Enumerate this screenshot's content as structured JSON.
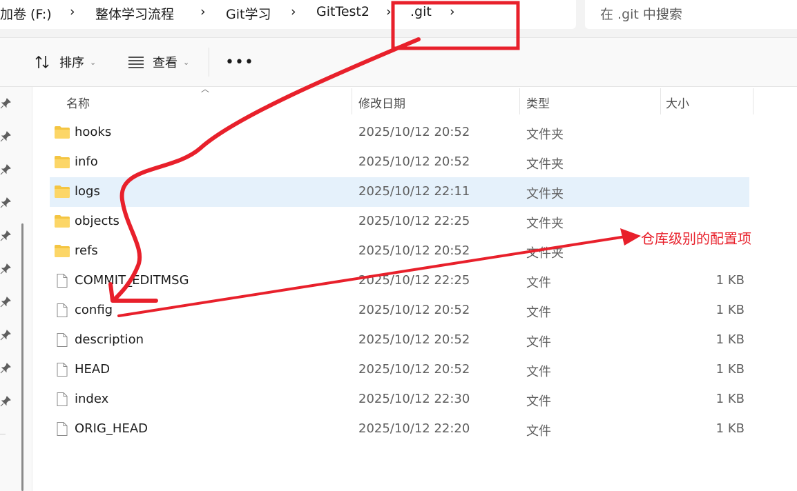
{
  "breadcrumb": {
    "items": [
      "加卷 (F:)",
      "整体学习流程",
      "Git学习",
      "GitTest2",
      ".git"
    ],
    "separator": ">"
  },
  "search": {
    "placeholder": "在 .git 中搜索"
  },
  "toolbar": {
    "sort_label": "排序",
    "view_label": "查看",
    "more_label": "•••"
  },
  "columns": {
    "name": "名称",
    "modified": "修改日期",
    "type": "类型",
    "size": "大小"
  },
  "files": [
    {
      "name": "hooks",
      "modified": "2025/10/12 20:52",
      "type": "文件夹",
      "size": "",
      "kind": "folder"
    },
    {
      "name": "info",
      "modified": "2025/10/12 20:52",
      "type": "文件夹",
      "size": "",
      "kind": "folder"
    },
    {
      "name": "logs",
      "modified": "2025/10/12 22:11",
      "type": "文件夹",
      "size": "",
      "kind": "folder",
      "selected": true
    },
    {
      "name": "objects",
      "modified": "2025/10/12 22:25",
      "type": "文件夹",
      "size": "",
      "kind": "folder"
    },
    {
      "name": "refs",
      "modified": "2025/10/12 20:52",
      "type": "文件夹",
      "size": "",
      "kind": "folder"
    },
    {
      "name": "COMMIT_EDITMSG",
      "modified": "2025/10/12 22:25",
      "type": "文件",
      "size": "1 KB",
      "kind": "file"
    },
    {
      "name": "config",
      "modified": "2025/10/12 20:52",
      "type": "文件",
      "size": "1 KB",
      "kind": "file"
    },
    {
      "name": "description",
      "modified": "2025/10/12 20:52",
      "type": "文件",
      "size": "1 KB",
      "kind": "file"
    },
    {
      "name": "HEAD",
      "modified": "2025/10/12 20:52",
      "type": "文件",
      "size": "1 KB",
      "kind": "file"
    },
    {
      "name": "index",
      "modified": "2025/10/12 22:30",
      "type": "文件",
      "size": "1 KB",
      "kind": "file"
    },
    {
      "name": "ORIG_HEAD",
      "modified": "2025/10/12 22:20",
      "type": "文件",
      "size": "1 KB",
      "kind": "file"
    }
  ],
  "annotation": {
    "text": "仓库级别的配置项",
    "color": "#e8202b"
  },
  "colors": {
    "selection": "#e5f1fb",
    "folder": "#f4c542",
    "accent_red": "#e8202b"
  }
}
